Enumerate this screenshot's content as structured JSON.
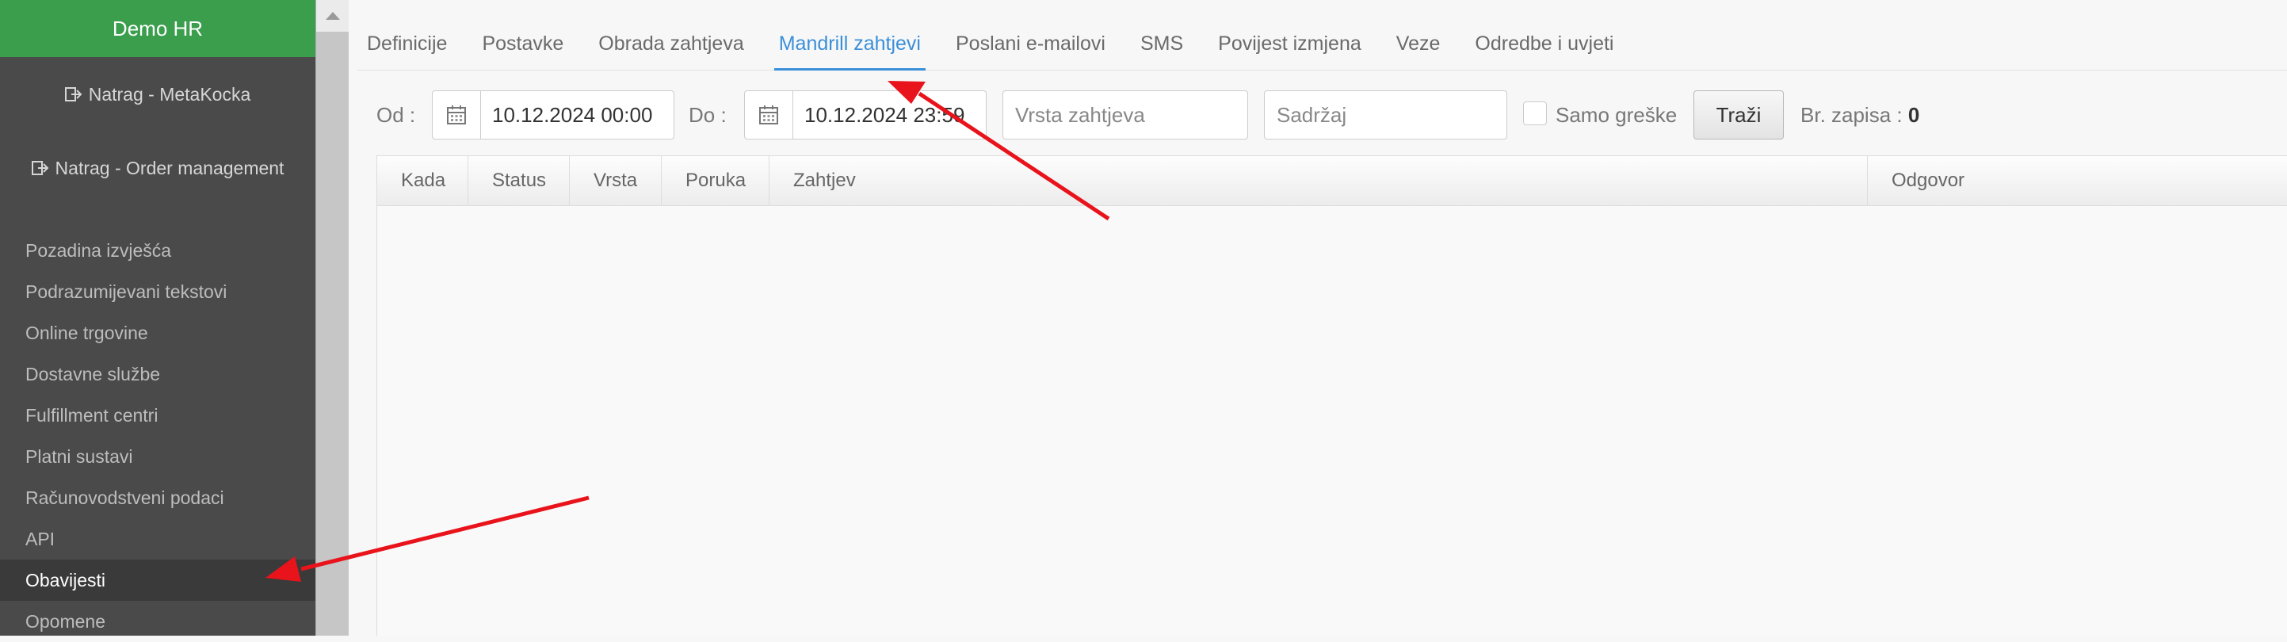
{
  "sidebar": {
    "brand": "Demo HR",
    "back_links": [
      {
        "label": "Natrag - MetaKocka",
        "icon": "exit-icon"
      },
      {
        "label": "Natrag - Order management",
        "icon": "exit-icon"
      }
    ],
    "items": [
      {
        "label": "Pozadina izvješća"
      },
      {
        "label": "Podrazumijevani tekstovi"
      },
      {
        "label": "Online trgovine"
      },
      {
        "label": "Dostavne službe"
      },
      {
        "label": "Fulfillment centri"
      },
      {
        "label": "Platni sustavi"
      },
      {
        "label": "Računovodstveni podaci"
      },
      {
        "label": "API"
      },
      {
        "label": "Obavijesti",
        "active": true
      },
      {
        "label": "Opomene"
      }
    ]
  },
  "tabs": [
    {
      "label": "Definicije"
    },
    {
      "label": "Postavke"
    },
    {
      "label": "Obrada zahtjeva"
    },
    {
      "label": "Mandrill zahtjevi",
      "active": true
    },
    {
      "label": "Poslani e-mailovi"
    },
    {
      "label": "SMS"
    },
    {
      "label": "Povijest izmjena"
    },
    {
      "label": "Veze"
    },
    {
      "label": "Odredbe i uvjeti"
    }
  ],
  "filters": {
    "from_label": "Od :",
    "from_value": "10.12.2024 00:00",
    "to_label": "Do :",
    "to_value": "10.12.2024 23:59",
    "request_type_placeholder": "Vrsta zahtjeva",
    "content_placeholder": "Sadržaj",
    "only_errors_label": "Samo greške",
    "search_button": "Traži",
    "count_label": "Br. zapisa :",
    "count_value": "0"
  },
  "table": {
    "columns": [
      "Kada",
      "Status",
      "Vrsta",
      "Poruka",
      "Zahtjev",
      "Odgovor"
    ],
    "rows": []
  },
  "colors": {
    "brand_green": "#3a9e4d",
    "sidebar_bg": "#4a4a4a",
    "active_tab": "#3b8fd9",
    "annotation_arrow": "#e8131b"
  }
}
